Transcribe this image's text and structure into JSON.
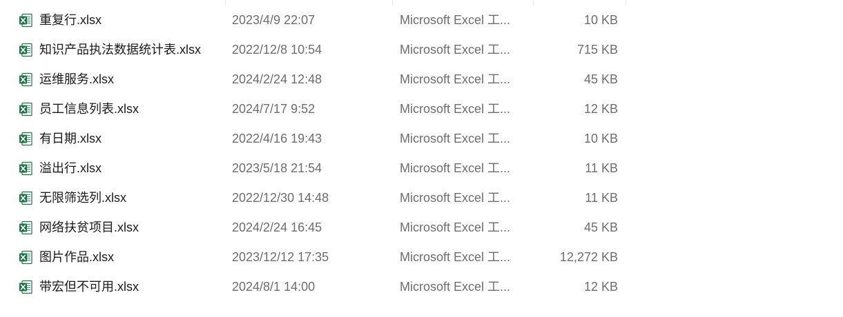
{
  "files": [
    {
      "name": "重复行.xlsx",
      "modified": "2023/4/9 22:07",
      "type": "Microsoft Excel 工...",
      "size": "10 KB",
      "icon": "excel-file-icon"
    },
    {
      "name": "知识产品执法数据统计表.xlsx",
      "modified": "2022/12/8 10:54",
      "type": "Microsoft Excel 工...",
      "size": "715 KB",
      "icon": "excel-file-icon"
    },
    {
      "name": "运维服务.xlsx",
      "modified": "2024/2/24 12:48",
      "type": "Microsoft Excel 工...",
      "size": "45 KB",
      "icon": "excel-file-icon"
    },
    {
      "name": "员工信息列表.xlsx",
      "modified": "2024/7/17 9:52",
      "type": "Microsoft Excel 工...",
      "size": "12 KB",
      "icon": "excel-file-icon"
    },
    {
      "name": "有日期.xlsx",
      "modified": "2022/4/16 19:43",
      "type": "Microsoft Excel 工...",
      "size": "10 KB",
      "icon": "excel-file-icon"
    },
    {
      "name": "溢出行.xlsx",
      "modified": "2023/5/18 21:54",
      "type": "Microsoft Excel 工...",
      "size": "11 KB",
      "icon": "excel-file-icon"
    },
    {
      "name": "无限筛选列.xlsx",
      "modified": "2022/12/30 14:48",
      "type": "Microsoft Excel 工...",
      "size": "11 KB",
      "icon": "excel-file-icon"
    },
    {
      "name": "网络扶贫项目.xlsx",
      "modified": "2024/2/24 16:45",
      "type": "Microsoft Excel 工...",
      "size": "45 KB",
      "icon": "excel-file-icon"
    },
    {
      "name": "图片作品.xlsx",
      "modified": "2023/12/12 17:35",
      "type": "Microsoft Excel 工...",
      "size": "12,272 KB",
      "icon": "excel-file-icon"
    },
    {
      "name": "带宏但不可用.xlsx",
      "modified": "2024/8/1 14:00",
      "type": "Microsoft Excel 工...",
      "size": "12 KB",
      "icon": "excel-file-icon"
    }
  ],
  "colors": {
    "excel_green": "#1f7244",
    "excel_green_light": "#21a366",
    "name_text": "#1a1a1a",
    "meta_text": "#6d6d6d"
  }
}
